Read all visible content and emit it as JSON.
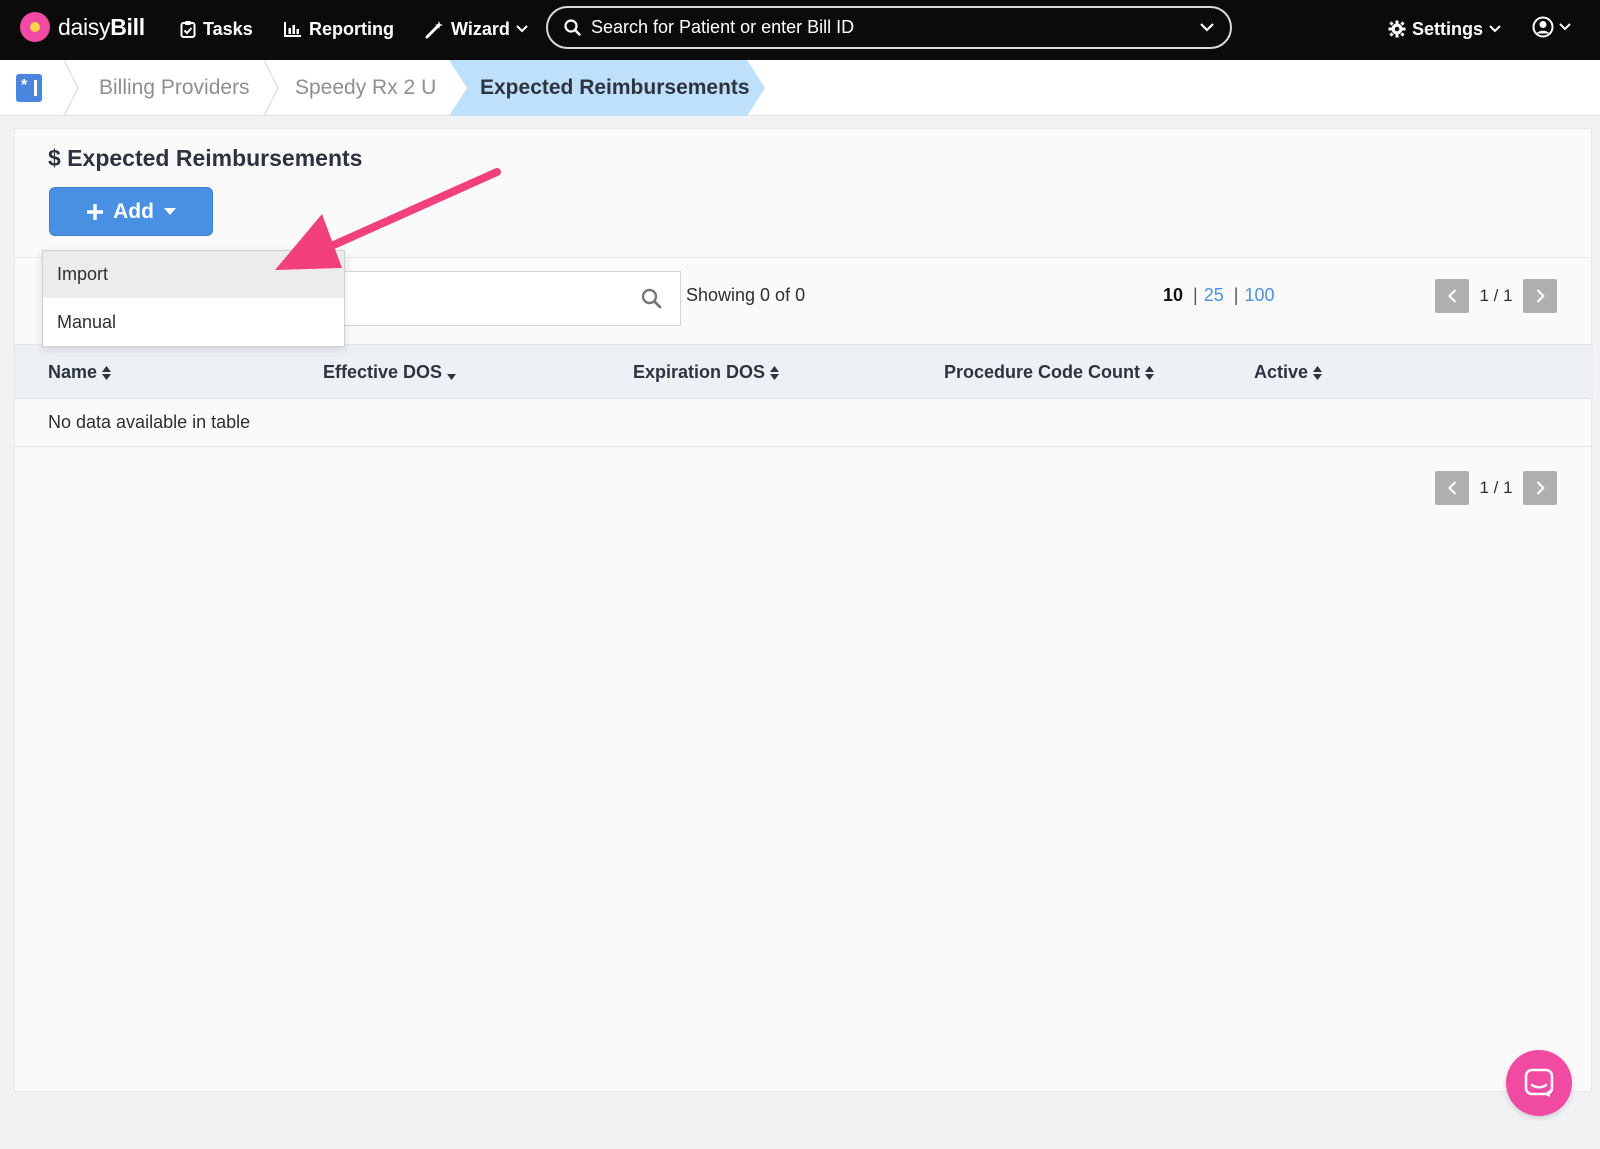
{
  "app": {
    "logo_light": "daisy",
    "logo_bold": "Bill"
  },
  "nav": {
    "tasks": "Tasks",
    "reporting": "Reporting",
    "wizard": "Wizard",
    "search_placeholder": "Search for Patient or enter Bill ID",
    "settings": "Settings"
  },
  "breadcrumb": {
    "items": [
      "Billing Providers",
      "Speedy Rx 2 U"
    ],
    "active": "Expected Reimbursements"
  },
  "page": {
    "title": "$ Expected Reimbursements",
    "add_label": "Add",
    "dropdown": [
      "Import",
      "Manual"
    ],
    "showing": "Showing 0 of 0",
    "page_size": {
      "current": "10",
      "options": [
        "25",
        "100"
      ],
      "sep": "|"
    },
    "pager": "1 / 1",
    "columns": [
      "Name",
      "Effective DOS",
      "Expiration DOS",
      "Procedure Code Count",
      "Active"
    ],
    "empty": "No data available in table"
  },
  "colors": {
    "accent": "#4a90e2",
    "brand_pink": "#f04aa3",
    "annotation": "#f2417a"
  },
  "icons": [
    "clipboard-check-icon",
    "bar-chart-icon",
    "magic-wand-icon",
    "search-icon",
    "gear-icon",
    "user-circle-icon",
    "sort-icon",
    "chevron-left-icon",
    "chevron-right-icon",
    "chat-icon"
  ]
}
